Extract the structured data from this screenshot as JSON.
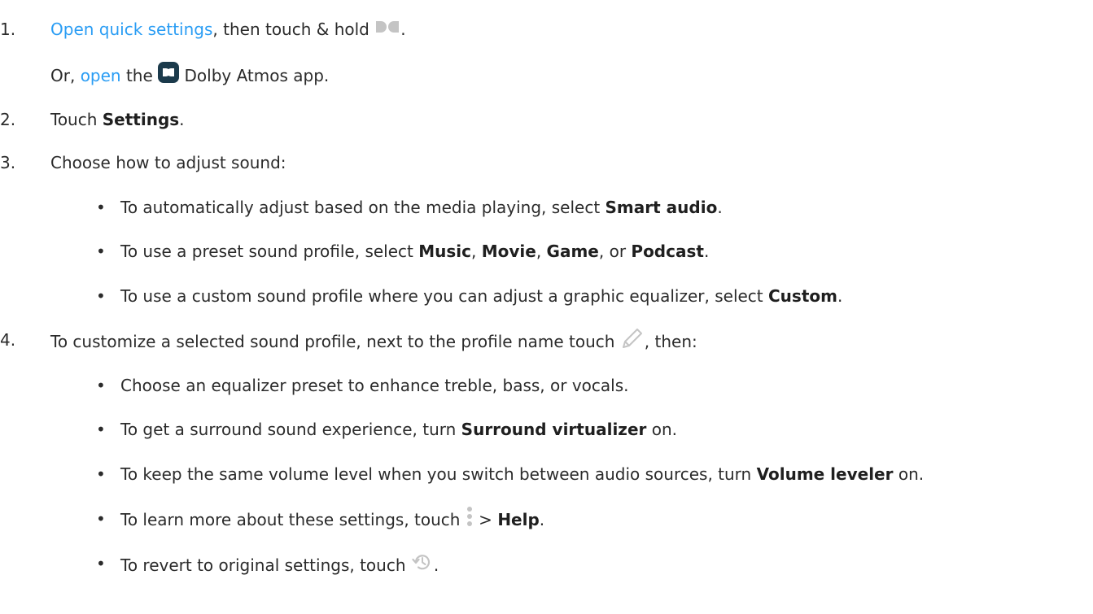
{
  "steps": {
    "s1": {
      "num": "1.",
      "link_text": "Open quick settings",
      "text_after_link": ", then touch & hold",
      "end": ".",
      "icon": "dolby-toggle-icon",
      "alt_prefix": "Or, ",
      "alt_link": "open",
      "alt_the": " the ",
      "alt_app_icon": "dolby-app-icon",
      "alt_rest": " Dolby Atmos app."
    },
    "s2": {
      "num": "2.",
      "pre": "Touch ",
      "bold": "Settings",
      "post": "."
    },
    "s3": {
      "num": "3.",
      "text": "Choose how to adjust sound:",
      "b1": {
        "pre": "To automatically adjust based on the media playing, select ",
        "bold": "Smart audio",
        "post": "."
      },
      "b2": {
        "pre": "To use a preset sound profile, select ",
        "bold1": "Music",
        "sep1": ", ",
        "bold2": "Movie",
        "sep2": ", ",
        "bold3": "Game",
        "sep3": ", or ",
        "bold4": "Podcast",
        "post": "."
      },
      "b3": {
        "pre": "To use a custom sound profile where you can adjust a graphic equalizer, select ",
        "bold": "Custom",
        "post": "."
      }
    },
    "s4": {
      "num": "4.",
      "pre": "To customize a selected sound profile, next to the profile name touch ",
      "icon": "pencil-icon",
      "post": ", then:",
      "b1": {
        "text": "Choose an equalizer preset to enhance treble, bass, or vocals."
      },
      "b2": {
        "pre": "To get a surround sound experience, turn ",
        "bold": "Surround virtualizer",
        "post": " on."
      },
      "b3": {
        "pre": "To keep the same volume level when you switch between audio sources, turn ",
        "bold": "Volume leveler",
        "post": " on."
      },
      "b4": {
        "pre": "To learn more about these settings, touch ",
        "icon": "more-vert-icon",
        "sep": " > ",
        "bold": "Help",
        "post": "."
      },
      "b5": {
        "pre": "To revert to original settings, touch ",
        "icon": "restore-icon",
        "post": "."
      }
    }
  },
  "bullet": "•",
  "colors": {
    "text": "#2b2b2b",
    "link": "#2a9df4",
    "icon_gray": "#c4c4c4",
    "dolby_app_bg": "#1b3a4b"
  }
}
